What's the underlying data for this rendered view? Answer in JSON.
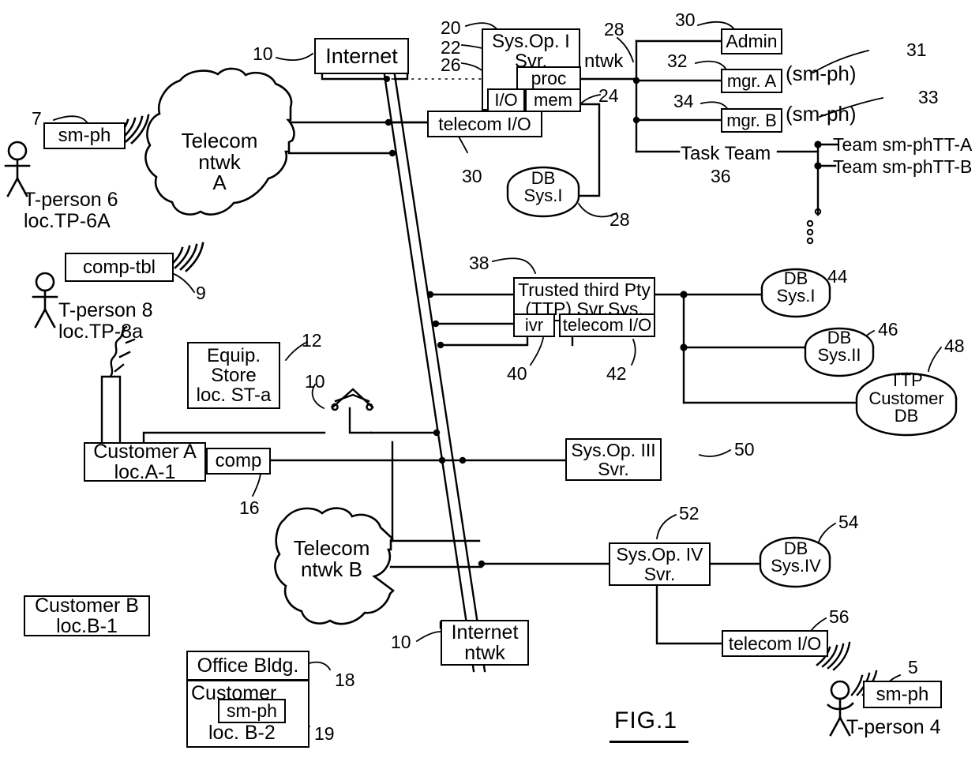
{
  "figure": {
    "label": "FIG.1",
    "title": "FIG.1"
  },
  "boxes": {
    "internet_top": {
      "label": "Internet",
      "ref": "10"
    },
    "sysop1": {
      "label": "Sys.Op. I\nSvr.",
      "ref": "20"
    },
    "proc": {
      "label": "proc",
      "ref": "22"
    },
    "io": {
      "label": "I/O",
      "ref": "26"
    },
    "mem": {
      "label": "mem",
      "ref": "24"
    },
    "telecom_io_top": {
      "label": "telecom I/O",
      "ref": "30"
    },
    "admin": {
      "label": "Admin",
      "ref": "30"
    },
    "mgr_a": {
      "label": "mgr. A",
      "ref": "32",
      "note": "(sm-ph)",
      "note_ref": "31"
    },
    "mgr_b": {
      "label": "mgr. B",
      "ref": "34",
      "note": "(sm-ph)",
      "note_ref": "33"
    },
    "task_team": {
      "label": "Task Team",
      "ref": "36"
    },
    "team_a": {
      "label": "Team sm-phTT-A"
    },
    "team_b": {
      "label": "Team sm-phTT-B"
    },
    "ttp": {
      "label": "Trusted third Pty\n(TTP) Svr.Sys.",
      "ref": "38"
    },
    "ivr": {
      "label": "ivr",
      "ref": "40"
    },
    "telecom_io_ttp": {
      "label": "telecom I/O",
      "ref": "42"
    },
    "equip_store": {
      "label": "Equip.\nStore\nloc. ST-a",
      "ref": "12"
    },
    "customer_a": {
      "label": "Customer A\nloc.A-1"
    },
    "comp": {
      "label": "comp",
      "ref": "16"
    },
    "sysop3": {
      "label": "Sys.Op. III\nSvr.",
      "ref": "50"
    },
    "sysop4": {
      "label": "Sys.Op. IV\nSvr.",
      "ref": "52"
    },
    "telecom_io_bottom": {
      "label": "telecom I/O",
      "ref": "56"
    },
    "customer_b": {
      "label": "Customer B\nloc.B-1"
    },
    "office_bldg": {
      "label": "Office Bldg.",
      "ref": "18"
    },
    "office_customer_b": {
      "label": "Customer\nB",
      "loc": "loc. B-2"
    },
    "office_smph": {
      "label": "sm-ph",
      "ref": "19"
    },
    "internet_ntwk": {
      "label": "Internet\nntwk",
      "ref": "10"
    },
    "smph_tp6": {
      "label": "sm-ph",
      "ref": "7"
    },
    "comp_tbl": {
      "label": "comp-tbl",
      "ref": "9"
    },
    "smph_tp4": {
      "label": "sm-ph",
      "ref": "5"
    }
  },
  "clouds": {
    "telecom_a": {
      "label": "Telecom\nntwk\nA"
    },
    "telecom_b": {
      "label": "Telecom\nntwk B"
    }
  },
  "cylinders": {
    "db_sys1_top": {
      "label": "DB\nSys.I",
      "ref": "28"
    },
    "db_sys1_ttp": {
      "label": "DB\nSys.I",
      "ref": "44"
    },
    "db_sys2": {
      "label": "DB\nSys.II",
      "ref": "46"
    },
    "ttp_customer_db": {
      "label": "TTP\nCustomer\nDB",
      "ref": "48"
    },
    "db_sys4": {
      "label": "DB\nSys.IV",
      "ref": "54"
    }
  },
  "people": {
    "tperson6": {
      "label": "T-person 6\nloc.TP-6A"
    },
    "tperson8": {
      "label": "T-person 8\nloc.TP-8a"
    },
    "tperson4": {
      "label": "T-person 4"
    }
  },
  "link_labels": {
    "ntwk": "ntwk"
  },
  "refs": {
    "ref_28_ntwk": "28"
  },
  "colors": {
    "ink": "#000000",
    "paper": "#ffffff"
  }
}
